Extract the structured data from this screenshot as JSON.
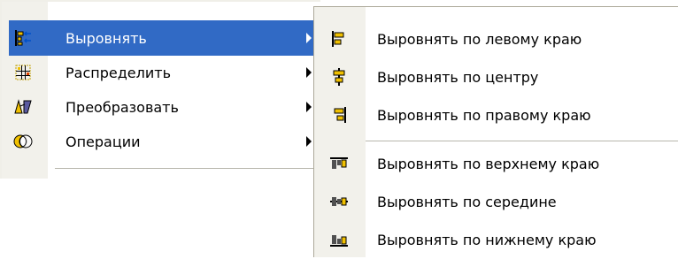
{
  "main_menu": {
    "items": [
      {
        "label": "Выровнять",
        "icon": "align-icon",
        "has_submenu": true,
        "selected": true
      },
      {
        "label": "Распределить",
        "icon": "distribute-icon",
        "has_submenu": true,
        "selected": false
      },
      {
        "label": "Преобразовать",
        "icon": "transform-icon",
        "has_submenu": true,
        "selected": false
      },
      {
        "label": "Операции",
        "icon": "operations-icon",
        "has_submenu": true,
        "selected": false
      }
    ]
  },
  "submenu": {
    "items": [
      {
        "label": "Выровнять по левому краю",
        "icon": "align-left-icon"
      },
      {
        "label": "Выровнять по центру",
        "icon": "align-center-icon"
      },
      {
        "label": "Выровнять по правому краю",
        "icon": "align-right-icon"
      },
      {
        "label": "Выровнять по верхнему краю",
        "icon": "align-top-icon"
      },
      {
        "label": "Выровнять по середине",
        "icon": "align-middle-icon"
      },
      {
        "label": "Выровнять по нижнему краю",
        "icon": "align-bottom-icon"
      }
    ]
  },
  "colors": {
    "selection": "#316ac5",
    "gutter": "#f2f1eb",
    "icon_yellow": "#f0c000",
    "icon_dark": "#505050"
  }
}
